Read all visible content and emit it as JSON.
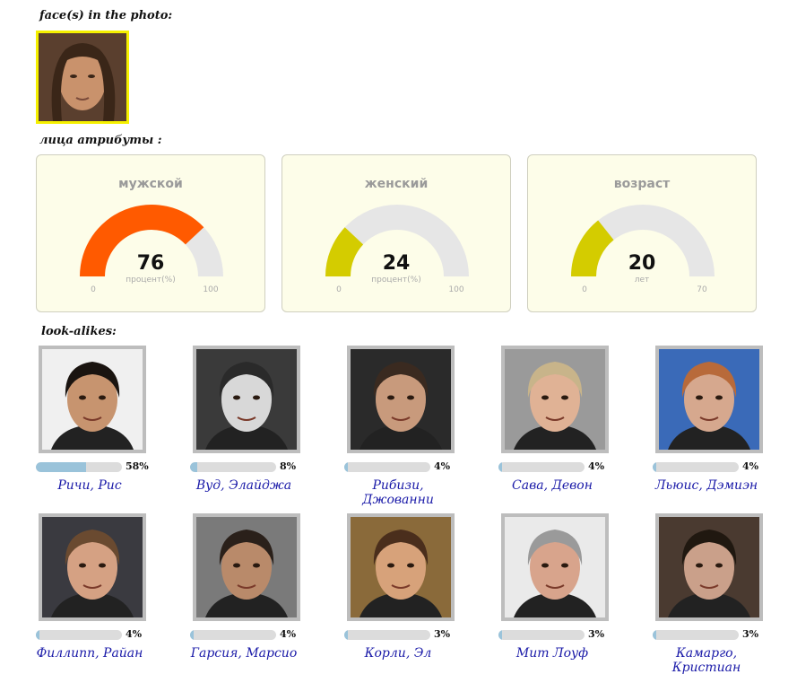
{
  "headings": {
    "faces": "face(s) in the photo:",
    "attributes": "лица атрибуты :",
    "lookalikes": "look-alikes:"
  },
  "gauges": [
    {
      "title": "мужской",
      "value": "76",
      "unit": "процент(%)",
      "min": "0",
      "max": "100",
      "fraction": 0.76,
      "color": "#ff5a00"
    },
    {
      "title": "женский",
      "value": "24",
      "unit": "процент(%)",
      "min": "0",
      "max": "100",
      "fraction": 0.24,
      "color": "#d4cc00"
    },
    {
      "title": "возраст",
      "value": "20",
      "unit": "лет",
      "min": "0",
      "max": "70",
      "fraction": 0.2857,
      "color": "#d4cc00"
    }
  ],
  "lookalikes": [
    {
      "name": "Ричи, Рис",
      "percent": "58%",
      "fraction": 0.58
    },
    {
      "name": "Вуд, Элайджа",
      "percent": "8%",
      "fraction": 0.08
    },
    {
      "name": "Рибизи, Джованни",
      "percent": "4%",
      "fraction": 0.04
    },
    {
      "name": "Сава, Девон",
      "percent": "4%",
      "fraction": 0.04
    },
    {
      "name": "Льюис, Дэмиэн",
      "percent": "4%",
      "fraction": 0.04
    },
    {
      "name": "Филлипп, Райан",
      "percent": "4%",
      "fraction": 0.04
    },
    {
      "name": "Гарсия, Марсио",
      "percent": "4%",
      "fraction": 0.04
    },
    {
      "name": "Корли, Эл",
      "percent": "3%",
      "fraction": 0.03
    },
    {
      "name": "Мит Лоуф",
      "percent": "3%",
      "fraction": 0.03
    },
    {
      "name": "Камарго, Кристиан",
      "percent": "3%",
      "fraction": 0.03
    }
  ]
}
